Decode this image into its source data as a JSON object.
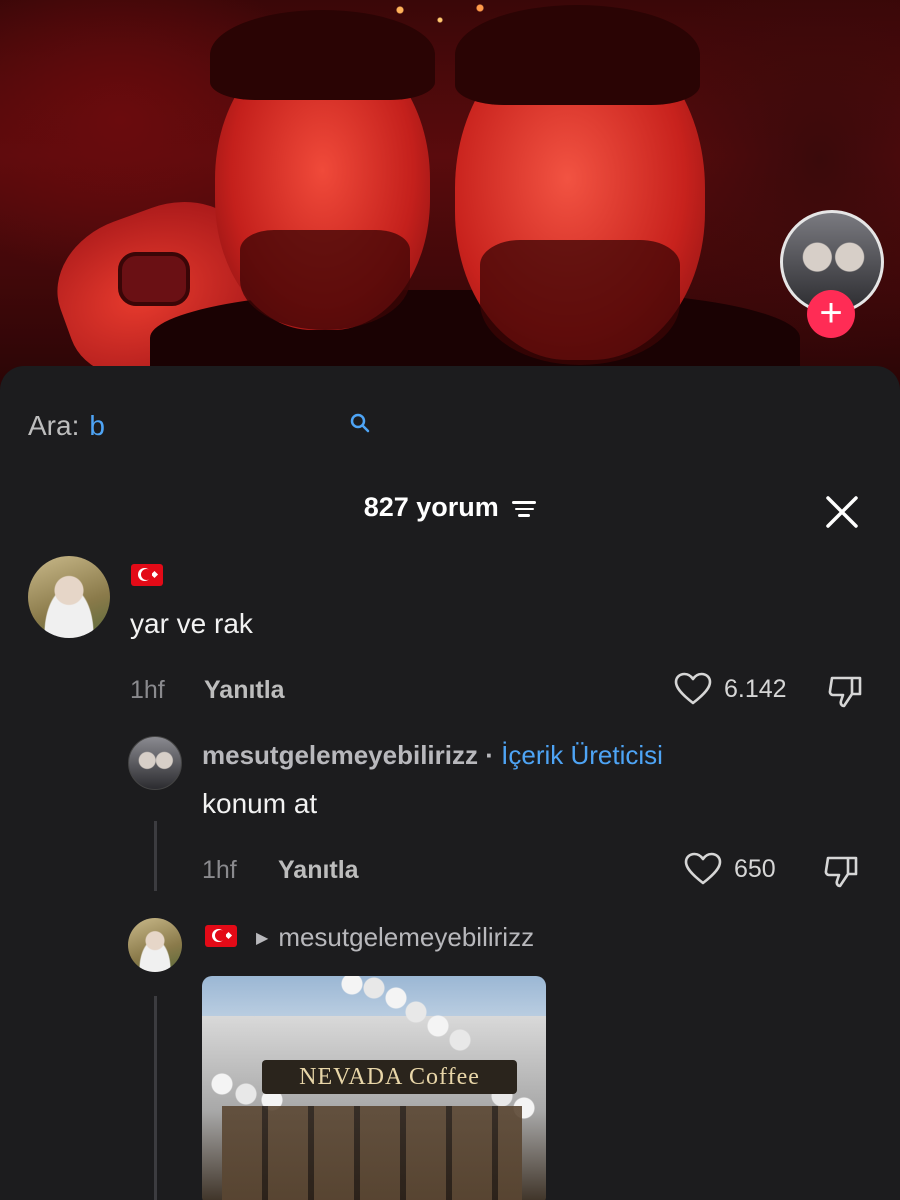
{
  "video": {
    "creator_follow_symbol": "+"
  },
  "search": {
    "label": "Ara:",
    "value_prefix": "b"
  },
  "comments_header": {
    "count_label": "827 yorum"
  },
  "comments": [
    {
      "flag": "Türkiye flag",
      "text": "yar ve rak",
      "time": "1hf",
      "reply_label": "Yanıtla",
      "likes": "6.142"
    }
  ],
  "replies": [
    {
      "username": "mesutgelemeyebilirizz",
      "separator": "·",
      "badge": "İçerik Üreticisi",
      "text": "konum at",
      "time": "1hf",
      "reply_label": "Yanıtla",
      "likes": "650"
    },
    {
      "flag": "Türkiye flag",
      "reply_to": "mesutgelemeyebilirizz",
      "photo_sign_text": "NEVADA Coffee"
    }
  ],
  "colors": {
    "background": "#1c1c1e",
    "accent_blue": "#4ea4f5",
    "follow_pink": "#ff2c55",
    "muted_text": "#8a8a8e"
  }
}
